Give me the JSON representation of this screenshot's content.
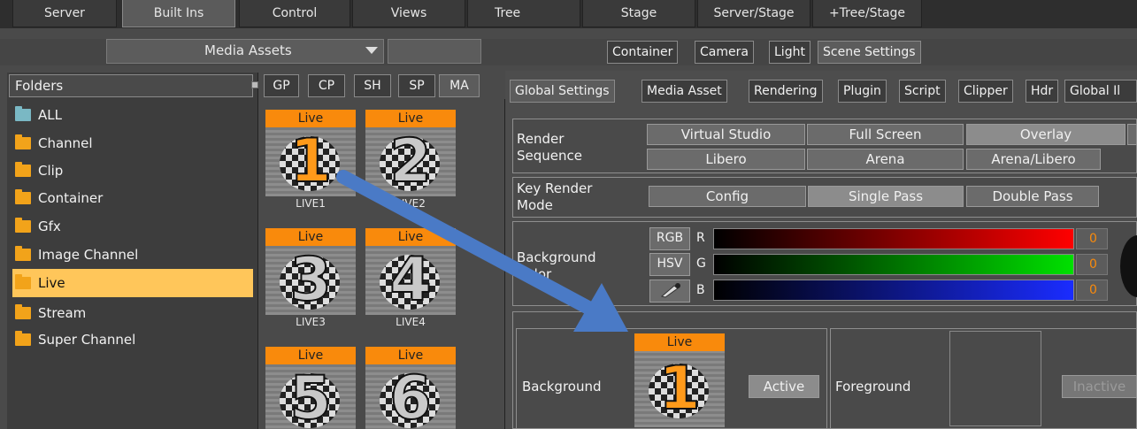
{
  "top_tabs": [
    "Server",
    "Built Ins",
    "Control",
    "Views",
    "Tree",
    "Stage",
    "Server/Stage",
    "+Tree/Stage"
  ],
  "media_dropdown": "Media Assets",
  "scene_tabs": [
    "Container",
    "Camera",
    "Light",
    "Scene Settings"
  ],
  "folders_header": "Folders",
  "folders": [
    "ALL",
    "Channel",
    "Clip",
    "Container",
    "Gfx",
    "Image Channel",
    "Live",
    "Stream",
    "Super Channel"
  ],
  "asset_tabs": [
    "GP",
    "CP",
    "SH",
    "SP",
    "MA"
  ],
  "thumbs": [
    {
      "badge": "Live",
      "num": "1",
      "caption": "LIVE1"
    },
    {
      "badge": "Live",
      "num": "2",
      "caption": "LIVE2"
    },
    {
      "badge": "Live",
      "num": "3",
      "caption": "LIVE3"
    },
    {
      "badge": "Live",
      "num": "4",
      "caption": "LIVE4"
    },
    {
      "badge": "Live",
      "num": "5",
      "caption": ""
    },
    {
      "badge": "Live",
      "num": "6",
      "caption": ""
    }
  ],
  "settings_tabs": [
    "Global Settings",
    "Media Asset",
    "Rendering",
    "Plugin",
    "Script",
    "Clipper",
    "Hdr",
    "Global Il"
  ],
  "render_sequence": {
    "label": "Render Sequence",
    "buttons": [
      "Virtual Studio",
      "Full Screen",
      "Overlay",
      "Libero",
      "Arena",
      "Arena/Libero"
    ]
  },
  "key_render": {
    "label": "Key Render Mode",
    "buttons": [
      "Config",
      "Single Pass",
      "Double Pass"
    ]
  },
  "bg_color": {
    "label": "Background Color",
    "mode_buttons": [
      "RGB",
      "HSV"
    ],
    "channels": [
      {
        "name": "R",
        "value": "0",
        "color": "#ff0000"
      },
      {
        "name": "G",
        "value": "0",
        "color": "#00e000"
      },
      {
        "name": "B",
        "value": "0",
        "color": "#1a2cff"
      }
    ]
  },
  "bottom": {
    "background_label": "Background",
    "background_thumb": {
      "badge": "Live",
      "num": "1"
    },
    "active_label": "Active",
    "foreground_label": "Foreground",
    "inactive_label": "Inactive"
  },
  "colors": {
    "accent_orange": "#f98a0c",
    "selection": "#ffc65a",
    "arrow": "#4a7ac6"
  }
}
